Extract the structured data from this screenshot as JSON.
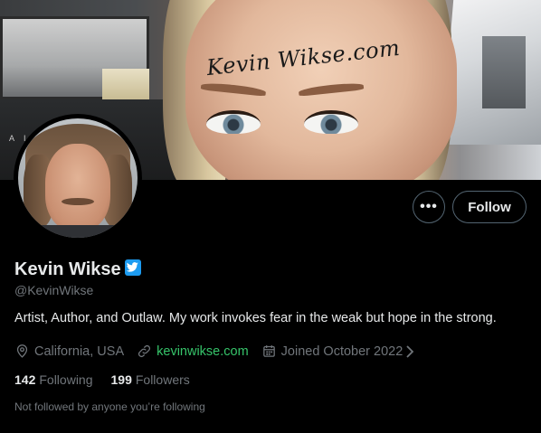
{
  "banner": {
    "watermark_text": "Kevin Wikse.com",
    "corner_mark": "A I"
  },
  "actions": {
    "more_glyph": "•••",
    "follow_label": "Follow"
  },
  "profile": {
    "display_name": "Kevin Wikse",
    "verified_icon": "verified-badge-icon",
    "handle": "@KevinWikse",
    "bio": "Artist, Author, and Outlaw. My work invokes fear in the weak but hope in the strong.",
    "location": "California, USA",
    "website": "kevinwikse.com",
    "joined": "Joined October 2022"
  },
  "stats": {
    "following_count": "142",
    "following_label": "Following",
    "followers_count": "199",
    "followers_label": "Followers"
  },
  "footer_note": "Not followed by anyone you’re following",
  "colors": {
    "background": "#000000",
    "primary_text": "#e7e9ea",
    "secondary_text": "#71767b",
    "verified_blue": "#1d9bf0",
    "link_green": "#36c46a",
    "button_border": "#536471"
  }
}
